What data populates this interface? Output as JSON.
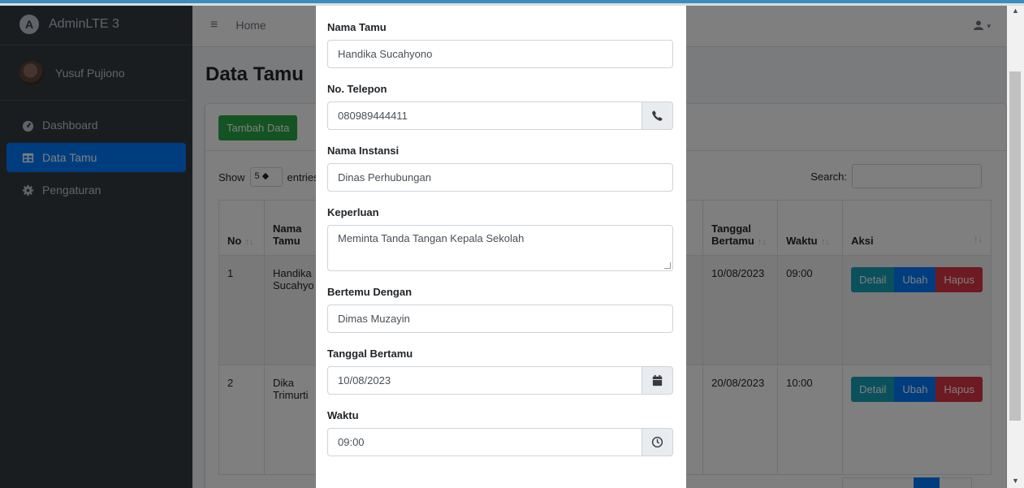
{
  "brand": {
    "name": "AdminLTE 3"
  },
  "user": {
    "name": "Yusuf Pujiono"
  },
  "sidebar": {
    "items": [
      {
        "label": "Dashboard",
        "icon": "dashboard-icon",
        "active": false
      },
      {
        "label": "Data Tamu",
        "icon": "table-icon",
        "active": true
      },
      {
        "label": "Pengaturan",
        "icon": "gear-icon",
        "active": false
      }
    ]
  },
  "navbar": {
    "menu_icon": "≡",
    "home_label": "Home",
    "user_icon": "▾"
  },
  "page": {
    "title": "Data Tamu"
  },
  "card": {
    "add_button": "Tambah Data",
    "show_label": "Show",
    "entries_label": "entries",
    "page_size": "5",
    "search_label": "Search:"
  },
  "table": {
    "headers": {
      "no": "No",
      "nama_line1": "Nama",
      "nama_line2": "Tamu",
      "tanggal_line1": "Tanggal",
      "tanggal_line2": "Bertamu",
      "waktu": "Waktu",
      "aksi": "Aksi"
    },
    "rows": [
      {
        "no": "1",
        "nama": "Handika Sucahyo",
        "tanggal": "10/08/2023",
        "waktu": "09:00"
      },
      {
        "no": "2",
        "nama": "Dika Trimurti",
        "tanggal": "20/08/2023",
        "waktu": "10:00"
      }
    ],
    "actions": {
      "detail": "Detail",
      "ubah": "Ubah",
      "hapus": "Hapus"
    }
  },
  "modal": {
    "fields": {
      "nama_tamu": {
        "label": "Nama Tamu",
        "value": "Handika Sucahyono"
      },
      "no_telepon": {
        "label": "No. Telepon",
        "value": "080989444411"
      },
      "nama_instansi": {
        "label": "Nama Instansi",
        "value": "Dinas Perhubungan"
      },
      "keperluan": {
        "label": "Keperluan",
        "value": "Meminta Tanda Tangan Kepala Sekolah"
      },
      "bertemu_dengan": {
        "label": "Bertemu Dengan",
        "value": "Dimas Muzayin"
      },
      "tanggal_bertamu": {
        "label": "Tanggal Bertamu",
        "value": "10/08/2023"
      },
      "waktu": {
        "label": "Waktu",
        "value": "09:00"
      }
    }
  },
  "colors": {
    "sidebar_bg": "#343a40",
    "primary": "#007bff",
    "success": "#28a745",
    "info": "#17a2b8",
    "danger": "#dc3545"
  }
}
